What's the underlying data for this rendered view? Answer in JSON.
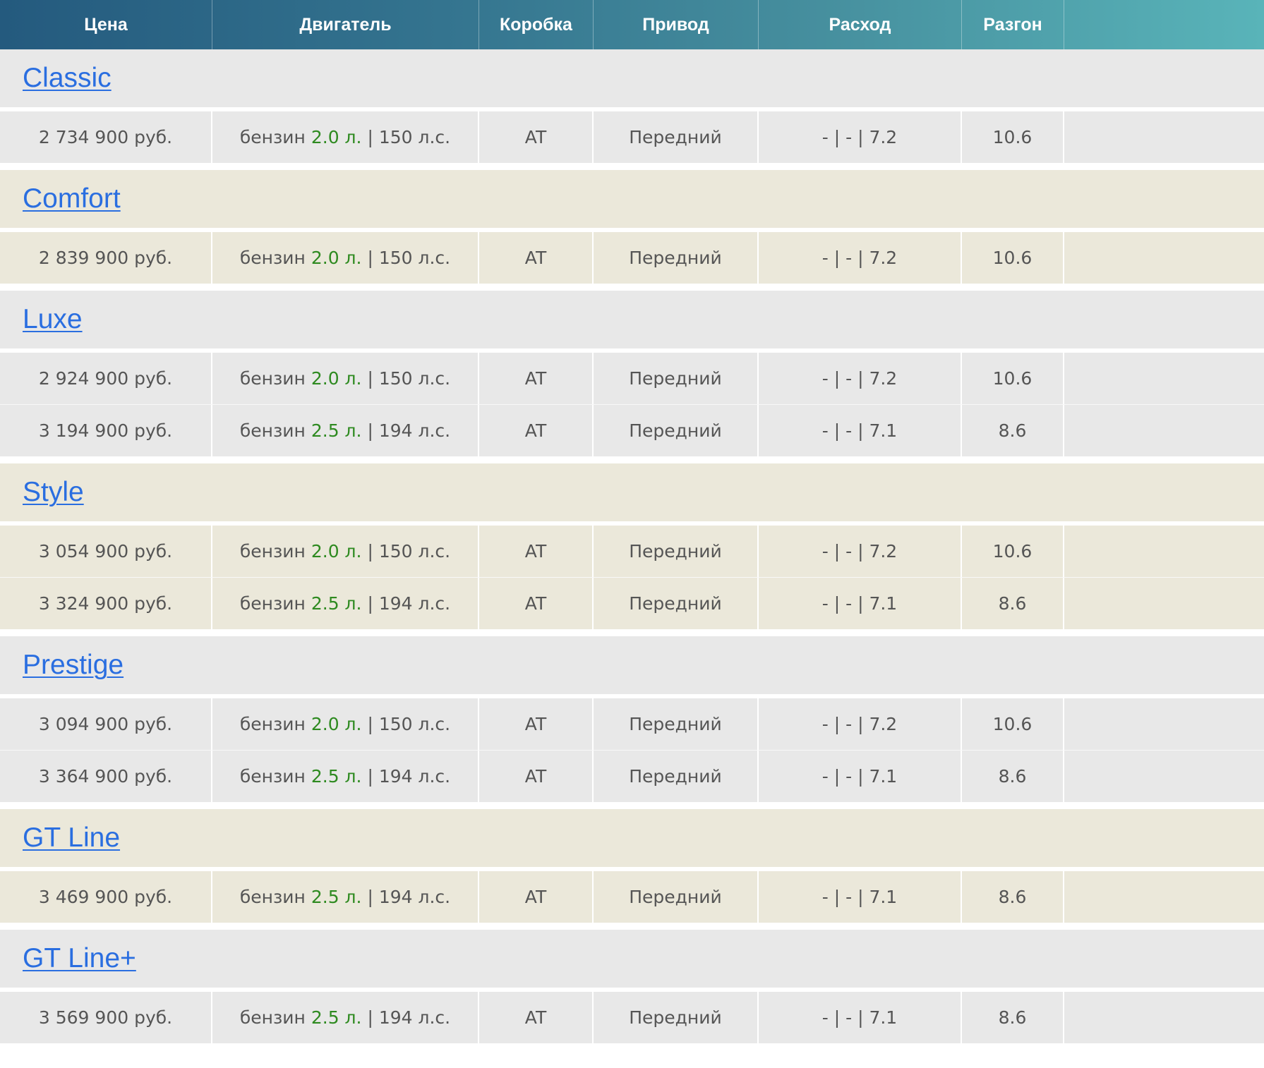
{
  "table": {
    "headers": [
      "Цена",
      "Двигатель",
      "Коробка",
      "Привод",
      "Расход",
      "Разгон"
    ],
    "groups": [
      {
        "name": "Classic",
        "bg": "gray",
        "rows": [
          {
            "price": "2 734 900 руб.",
            "fuel": "бензин",
            "volume": "2.0 л.",
            "sep": "|",
            "power": "150 л.с.",
            "gearbox": "AT",
            "drive": "Передний",
            "consumption": "- | - | 7.2",
            "acceleration": "10.6"
          }
        ]
      },
      {
        "name": "Comfort",
        "bg": "beige",
        "rows": [
          {
            "price": "2 839 900 руб.",
            "fuel": "бензин",
            "volume": "2.0 л.",
            "sep": "|",
            "power": "150 л.с.",
            "gearbox": "AT",
            "drive": "Передний",
            "consumption": "- | - | 7.2",
            "acceleration": "10.6"
          }
        ]
      },
      {
        "name": "Luxe",
        "bg": "gray",
        "rows": [
          {
            "price": "2 924 900 руб.",
            "fuel": "бензин",
            "volume": "2.0 л.",
            "sep": "|",
            "power": "150 л.с.",
            "gearbox": "AT",
            "drive": "Передний",
            "consumption": "- | - | 7.2",
            "acceleration": "10.6"
          },
          {
            "price": "3 194 900 руб.",
            "fuel": "бензин",
            "volume": "2.5 л.",
            "sep": "|",
            "power": "194 л.с.",
            "gearbox": "AT",
            "drive": "Передний",
            "consumption": "- | - | 7.1",
            "acceleration": "8.6"
          }
        ]
      },
      {
        "name": "Style",
        "bg": "beige",
        "rows": [
          {
            "price": "3 054 900 руб.",
            "fuel": "бензин",
            "volume": "2.0 л.",
            "sep": "|",
            "power": "150 л.с.",
            "gearbox": "AT",
            "drive": "Передний",
            "consumption": "- | - | 7.2",
            "acceleration": "10.6"
          },
          {
            "price": "3 324 900 руб.",
            "fuel": "бензин",
            "volume": "2.5 л.",
            "sep": "|",
            "power": "194 л.с.",
            "gearbox": "AT",
            "drive": "Передний",
            "consumption": "- | - | 7.1",
            "acceleration": "8.6"
          }
        ]
      },
      {
        "name": "Prestige",
        "bg": "gray",
        "rows": [
          {
            "price": "3 094 900 руб.",
            "fuel": "бензин",
            "volume": "2.0 л.",
            "sep": "|",
            "power": "150 л.с.",
            "gearbox": "AT",
            "drive": "Передний",
            "consumption": "- | - | 7.2",
            "acceleration": "10.6"
          },
          {
            "price": "3 364 900 руб.",
            "fuel": "бензин",
            "volume": "2.5 л.",
            "sep": "|",
            "power": "194 л.с.",
            "gearbox": "AT",
            "drive": "Передний",
            "consumption": "- | - | 7.1",
            "acceleration": "8.6"
          }
        ]
      },
      {
        "name": "GT Line",
        "bg": "beige",
        "rows": [
          {
            "price": "3 469 900 руб.",
            "fuel": "бензин",
            "volume": "2.5 л.",
            "sep": "|",
            "power": "194 л.с.",
            "gearbox": "AT",
            "drive": "Передний",
            "consumption": "- | - | 7.1",
            "acceleration": "8.6"
          }
        ]
      },
      {
        "name": "GT Line+",
        "bg": "gray",
        "rows": [
          {
            "price": "3 569 900 руб.",
            "fuel": "бензин",
            "volume": "2.5 л.",
            "sep": "|",
            "power": "194 л.с.",
            "gearbox": "AT",
            "drive": "Передний",
            "consumption": "- | - | 7.1",
            "acceleration": "8.6"
          }
        ]
      }
    ]
  },
  "colors": {
    "header_gradient_start": "#245a7e",
    "header_gradient_end": "#59b4b9",
    "link": "#2a6ee0",
    "engine_volume": "#2e8a20",
    "row_gray": "#e8e8e8",
    "row_beige": "#ebe8da",
    "text": "#555555"
  }
}
